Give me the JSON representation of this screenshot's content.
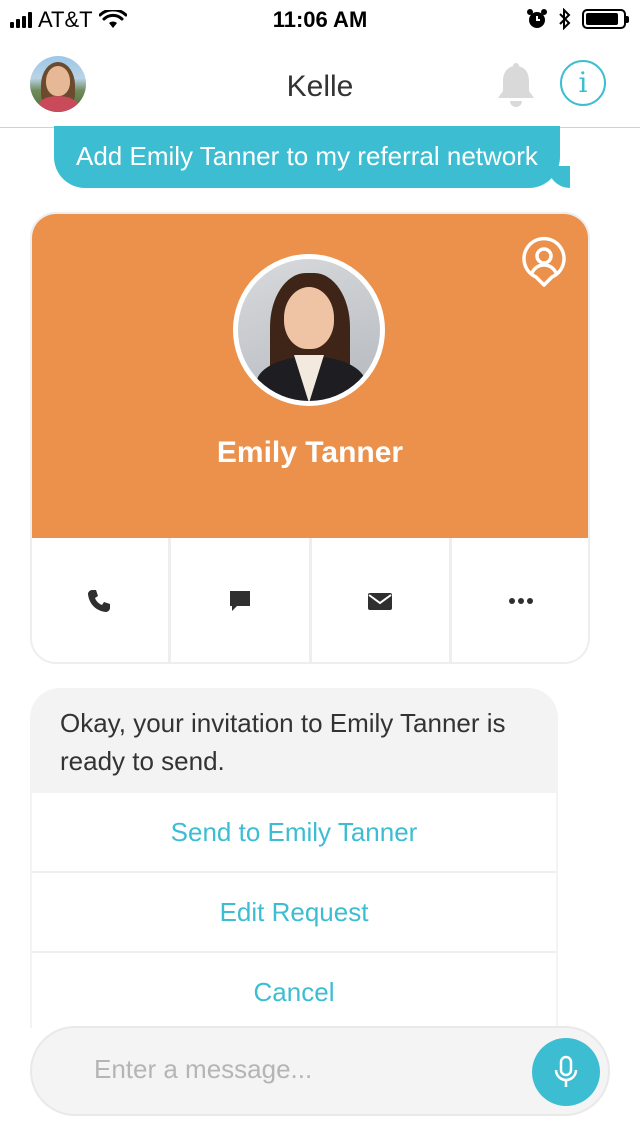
{
  "status_bar": {
    "carrier": "AT&T",
    "time": "11:06 AM",
    "battery_level": 0.85
  },
  "header": {
    "title": "Kelle",
    "info_glyph": "i",
    "icons": [
      "avatar",
      "bell-icon",
      "info-icon"
    ]
  },
  "user_message": {
    "text": "Add Emily Tanner to my referral network"
  },
  "contact_card": {
    "name": "Emily Tanner",
    "header_color": "#eb914b",
    "actions": [
      "phone-icon",
      "chat-icon",
      "mail-icon",
      "more-icon"
    ]
  },
  "assistant_message": {
    "text": "Okay, your invitation to Emily Tanner is ready to send.",
    "options": [
      "Send to Emily Tanner",
      "Edit Request",
      "Cancel"
    ]
  },
  "composer": {
    "placeholder": "Enter a message..."
  },
  "colors": {
    "accent": "#3dbdd1",
    "card_orange": "#eb914b"
  }
}
